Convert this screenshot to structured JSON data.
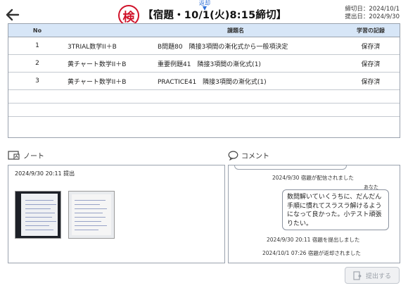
{
  "header": {
    "badge": "検",
    "title": "【宿題・10/1(火)8:15締切】",
    "returned_label": "返却",
    "deadline": "締切日：2024/10/1",
    "submitted": "提出日：2024/9/30"
  },
  "table": {
    "columns": {
      "no": "No",
      "title": "課題名",
      "record": "学習の記録"
    },
    "rows": [
      {
        "no": "1",
        "subject": "3TRIAL数学II＋B",
        "title": "B問題80　隣接3項間の漸化式から一般項決定",
        "record": "保存済"
      },
      {
        "no": "2",
        "subject": "黄チャート数学II＋B",
        "title": "重要例題41　隣接3項間の漸化式(1)",
        "record": "保存済"
      },
      {
        "no": "3",
        "subject": "黄チャート数学II＋B",
        "title": "PRACTICE41　隣接3項間の漸化式(1)",
        "record": "保存済"
      }
    ]
  },
  "note": {
    "label": "ノート",
    "date": "2024/9/30 20:11 提出"
  },
  "comment": {
    "label": "コメント",
    "delivered": "2024/9/30 宿題が配信されました",
    "you": "あなた",
    "message": "数問解いていくうちに、だんだん手順に慣れてスラスラ解けるようになって良かった。小テスト頑張りたい。",
    "submitted": "2024/9/30 20:11 宿題を提出しました",
    "returned": "2024/10/1 07:26 宿題が返却されました"
  },
  "submit_label": "提出する"
}
